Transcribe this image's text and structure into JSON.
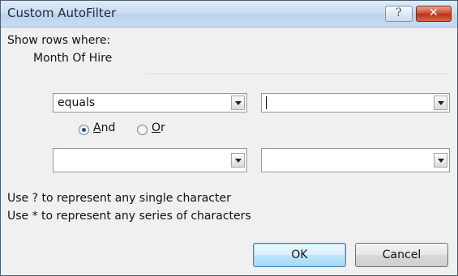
{
  "window": {
    "title": "Custom AutoFilter",
    "help_glyph": "?",
    "close_glyph": "✕"
  },
  "show_rows_label": "Show rows where:",
  "field_name": "Month Of Hire",
  "criteria1": {
    "operator": "equals",
    "value": ""
  },
  "logic": {
    "and_prefix": "",
    "and_key": "A",
    "and_rest": "nd",
    "or_key": "O",
    "or_rest": "r",
    "selected": "And"
  },
  "criteria2": {
    "operator": "",
    "value": ""
  },
  "hints": [
    "Use ? to represent any single character",
    "Use * to represent any series of characters"
  ],
  "buttons": {
    "ok": "OK",
    "cancel": "Cancel"
  }
}
